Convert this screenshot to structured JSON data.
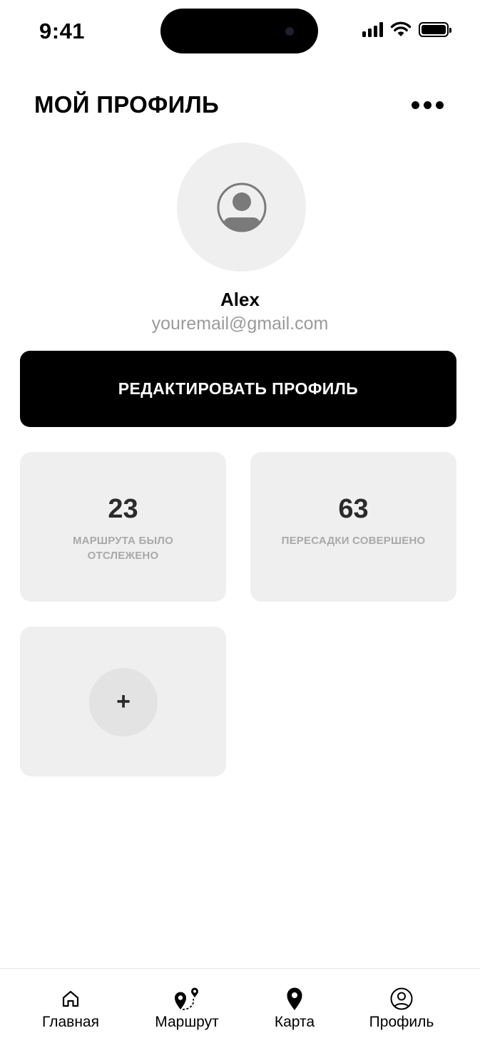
{
  "status_bar": {
    "time": "9:41"
  },
  "header": {
    "title": "МОЙ ПРОФИЛЬ",
    "more_icon": "ellipsis-icon"
  },
  "profile": {
    "avatar_icon": "user-circle-icon",
    "name": "Alex",
    "email": "youremail@gmail.com"
  },
  "edit_button": {
    "label": "РЕДАКТИРОВАТЬ ПРОФИЛЬ"
  },
  "stats": [
    {
      "value": "23",
      "label": "МАРШРУТА БЫЛО ОТСЛЕЖЕНО"
    },
    {
      "value": "63",
      "label": "ПЕРЕСАДКИ СОВЕРШЕНО"
    }
  ],
  "add_card": {
    "symbol": "+"
  },
  "tab_bar": {
    "items": [
      {
        "label": "Главная",
        "icon": "home-icon"
      },
      {
        "label": "Маршрут",
        "icon": "route-icon"
      },
      {
        "label": "Карта",
        "icon": "map-pin-icon"
      },
      {
        "label": "Профиль",
        "icon": "profile-icon"
      }
    ]
  },
  "colors": {
    "background": "#ffffff",
    "card": "#efefef",
    "primary_button": "#000000",
    "muted_text": "#9a9a9a",
    "stat_label": "#a9a9a9"
  }
}
